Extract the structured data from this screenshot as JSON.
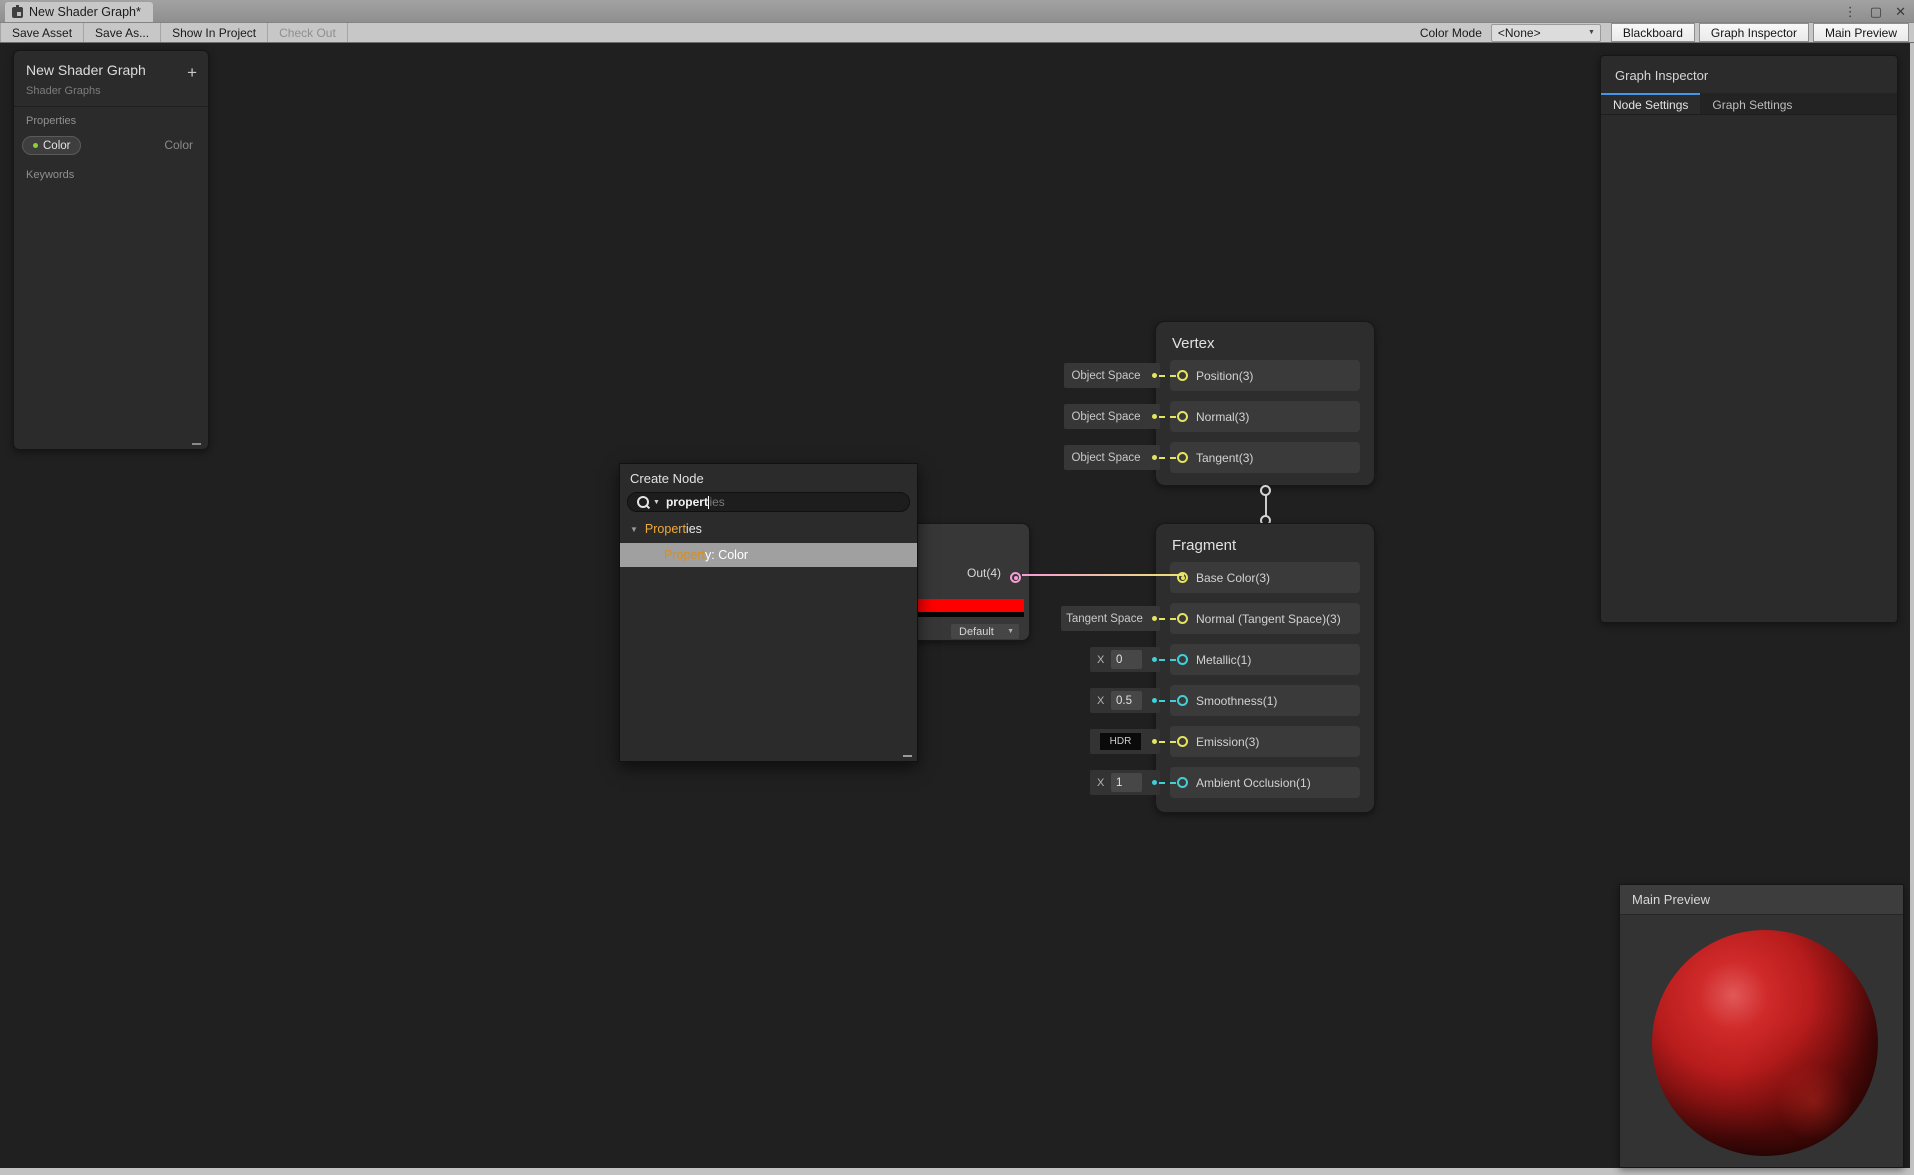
{
  "icons": {
    "caret_down": "▼",
    "foldout": "▼",
    "menu": "⋮",
    "maximize": "▢",
    "close": "✕",
    "plus": "+"
  },
  "window": {
    "tab_title": "New Shader Graph*"
  },
  "toolbar": {
    "save_asset": "Save Asset",
    "save_as": "Save As...",
    "show_in_project": "Show In Project",
    "check_out": "Check Out",
    "color_mode_label": "Color Mode",
    "color_mode_value": "<None>",
    "blackboard": "Blackboard",
    "graph_inspector": "Graph Inspector",
    "main_preview": "Main Preview"
  },
  "blackboard": {
    "title": "New Shader Graph",
    "subtitle": "Shader Graphs",
    "properties_label": "Properties",
    "keywords_label": "Keywords",
    "property": {
      "name": "Color",
      "type": "Color"
    }
  },
  "graph_inspector": {
    "title": "Graph Inspector",
    "tabs": [
      {
        "label": "Node Settings"
      },
      {
        "label": "Graph Settings"
      }
    ]
  },
  "main_preview": {
    "title": "Main Preview"
  },
  "create_node": {
    "title": "Create Node",
    "search_text": "propert",
    "search_hint": "ies",
    "category": {
      "match": "Propert",
      "rest": "ies"
    },
    "result": {
      "match": "Propert",
      "rest": "y: Color"
    }
  },
  "color_node": {
    "out_label": "Out(4)",
    "mode_value": "Default"
  },
  "vertex_node": {
    "title": "Vertex",
    "rows": [
      {
        "tag": "Object Space",
        "label": "Position(3)"
      },
      {
        "tag": "Object Space",
        "label": "Normal(3)"
      },
      {
        "tag": "Object Space",
        "label": "Tangent(3)"
      }
    ]
  },
  "fragment_node": {
    "title": "Fragment",
    "rows": [
      {
        "label": "Base Color(3)"
      },
      {
        "tag": "Tangent Space",
        "label": "Normal (Tangent Space)(3)"
      },
      {
        "x_label": "X",
        "value": "0",
        "label": "Metallic(1)"
      },
      {
        "x_label": "X",
        "value": "0.5",
        "label": "Smoothness(1)"
      },
      {
        "hdr_label": "HDR",
        "label": "Emission(3)"
      },
      {
        "x_label": "X",
        "value": "1",
        "label": "Ambient Occlusion(1)"
      }
    ]
  },
  "colors": {
    "accent-blue": "#4595e8",
    "port-yellow": "#e4e45f",
    "port-cyan": "#3fd0da",
    "port-pink": "#f79ad6",
    "wire-end": "#e9e473",
    "swatch-red": "#fe0000",
    "pill-dot-green": "#8bd32f",
    "match-orange": "#f0a93c",
    "match-orange-dark": "#d78f1e"
  }
}
